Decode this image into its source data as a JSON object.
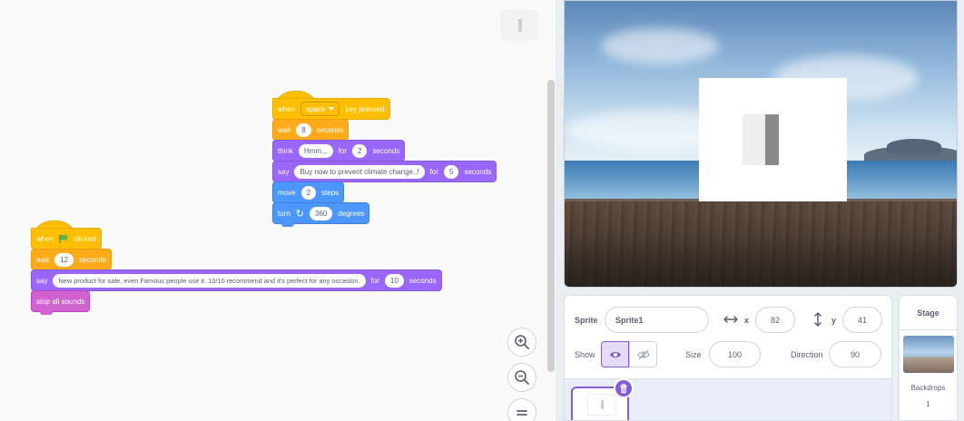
{
  "colors": {
    "events": "#ffbf00",
    "control": "#ffab19",
    "looks": "#9966ff",
    "motion": "#4c97ff",
    "sound": "#cf63cf",
    "accent": "#855cd6"
  },
  "script1": {
    "hat": {
      "when": "when",
      "key": "space",
      "suffix": "key pressed"
    },
    "wait": {
      "label": "wait",
      "value": "8",
      "unit": "seconds"
    },
    "think": {
      "label": "think",
      "text": "Hmm...",
      "for": "for",
      "value": "2",
      "unit": "seconds"
    },
    "say": {
      "label": "say",
      "text": "Buy now to prevent climate change..!",
      "for": "for",
      "value": "5",
      "unit": "seconds"
    },
    "move": {
      "label": "move",
      "value": "2",
      "unit": "steps"
    },
    "turn": {
      "label": "turn",
      "icon": "rotate-right-icon",
      "value": "360",
      "unit": "degrees"
    }
  },
  "script2": {
    "hat": {
      "when": "when",
      "icon": "green-flag-icon",
      "suffix": "clicked"
    },
    "wait": {
      "label": "wait",
      "value": "12",
      "unit": "seconds"
    },
    "say": {
      "label": "say",
      "text": "New product for sale, even Famous people use it. 10/10 recommend and it's perfect for any occasion.",
      "for": "for",
      "value": "10",
      "unit": "seconds"
    },
    "stop": {
      "label": "stop all sounds"
    }
  },
  "zoom": {
    "zoom_in_icon": "zoom-in-icon",
    "zoom_out_icon": "zoom-out-icon",
    "reset_icon": "zoom-reset-icon"
  },
  "sprite_info": {
    "sprite_label": "Sprite",
    "sprite_name": "Sprite1",
    "x_label": "x",
    "x_value": "82",
    "y_label": "y",
    "y_value": "41",
    "show_label": "Show",
    "size_label": "Size",
    "size_value": "100",
    "direction_label": "Direction",
    "direction_value": "90"
  },
  "stage_panel": {
    "title": "Stage",
    "backdrops_label": "Backdrops",
    "backdrops_count": "1"
  }
}
